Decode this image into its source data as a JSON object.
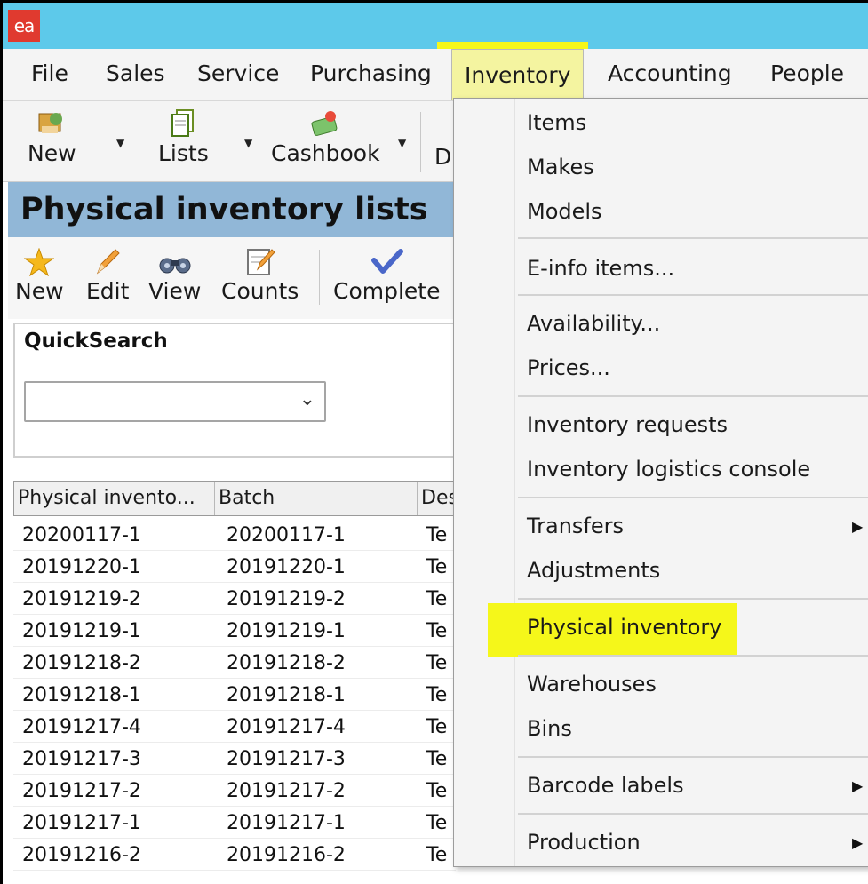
{
  "titlebar": {
    "logo_text": "ea"
  },
  "menubar": {
    "items": [
      "File",
      "Sales",
      "Service",
      "Purchasing",
      "Inventory",
      "Accounting",
      "People"
    ],
    "active": "Inventory"
  },
  "toolbar": {
    "new_label": "New",
    "lists_label": "Lists",
    "cashbook_label": "Cashbook",
    "overflow_label": "D"
  },
  "panel": {
    "title": "Physical inventory lists",
    "buttons": {
      "new": "New",
      "edit": "Edit",
      "view": "View",
      "counts": "Counts",
      "complete": "Complete"
    }
  },
  "quicksearch": {
    "label": "QuickSearch",
    "value": ""
  },
  "grid": {
    "headers": [
      "Physical invento...",
      "Batch",
      "Des"
    ],
    "rows": [
      [
        "20200117-1",
        "20200117-1",
        "Te"
      ],
      [
        "20191220-1",
        "20191220-1",
        "Te"
      ],
      [
        "20191219-2",
        "20191219-2",
        "Te"
      ],
      [
        "20191219-1",
        "20191219-1",
        "Te"
      ],
      [
        "20191218-2",
        "20191218-2",
        "Te"
      ],
      [
        "20191218-1",
        "20191218-1",
        "Te"
      ],
      [
        "20191217-4",
        "20191217-4",
        "Te"
      ],
      [
        "20191217-3",
        "20191217-3",
        "Te"
      ],
      [
        "20191217-2",
        "20191217-2",
        "Te"
      ],
      [
        "20191217-1",
        "20191217-1",
        "Te"
      ],
      [
        "20191216-2",
        "20191216-2",
        "Te"
      ]
    ]
  },
  "inventory_menu": {
    "items": [
      "Items",
      "Makes",
      "Models",
      "E-info items...",
      "Availability...",
      "Prices...",
      "Inventory requests",
      "Inventory logistics console",
      "Transfers",
      "Adjustments",
      "Physical inventory",
      "Warehouses",
      "Bins",
      "Barcode labels",
      "Production"
    ],
    "highlighted": "Physical inventory"
  },
  "colors": {
    "titlebar": "#5dc9ea",
    "panel_header": "#91b7d7",
    "highlight": "#f5f71a",
    "logo": "#e03a2f"
  },
  "icons": [
    "new-icon",
    "lists-icon",
    "cashbook-icon",
    "star-icon",
    "pencil-icon",
    "binoculars-icon",
    "counts-icon",
    "checkmark-icon",
    "chevron-down-icon",
    "submenu-arrow-icon"
  ]
}
